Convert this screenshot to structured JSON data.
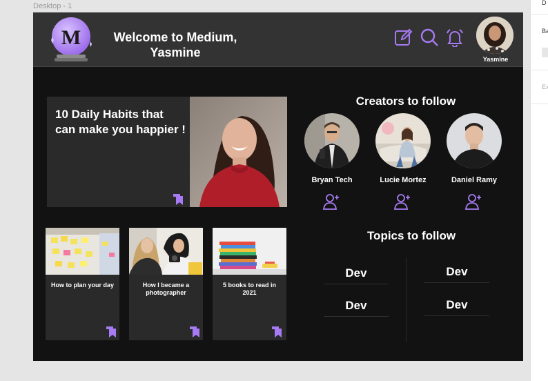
{
  "canvas": {
    "frame_label": "Desktop - 1",
    "right_panel": {
      "label_top": "D",
      "label_bg": "Ba",
      "label_export": "Ex"
    }
  },
  "header": {
    "logo_letter": "M",
    "welcome_line1": "Welcome to Medium,",
    "welcome_line2": "Yasmine",
    "icons": [
      "edit-icon",
      "search-icon",
      "bell-icon"
    ],
    "user_name": "Yasmine"
  },
  "featured": {
    "title": "10 Daily Habits that can make you happier !"
  },
  "cards": [
    {
      "title": "How to plan your day"
    },
    {
      "title": "How I became a photographer"
    },
    {
      "title": "5 books to read in 2021"
    }
  ],
  "creators": {
    "title": "Creators to follow",
    "items": [
      {
        "name": "Bryan Tech"
      },
      {
        "name": "Lucie Mortez"
      },
      {
        "name": "Daniel Ramy"
      }
    ]
  },
  "topics": {
    "title": "Topics to follow",
    "items": [
      "Dev",
      "Dev",
      "Dev",
      "Dev"
    ]
  },
  "colors": {
    "accent": "#a77bf3",
    "background": "#121212",
    "header": "#333333",
    "card": "#2a2a2a"
  }
}
